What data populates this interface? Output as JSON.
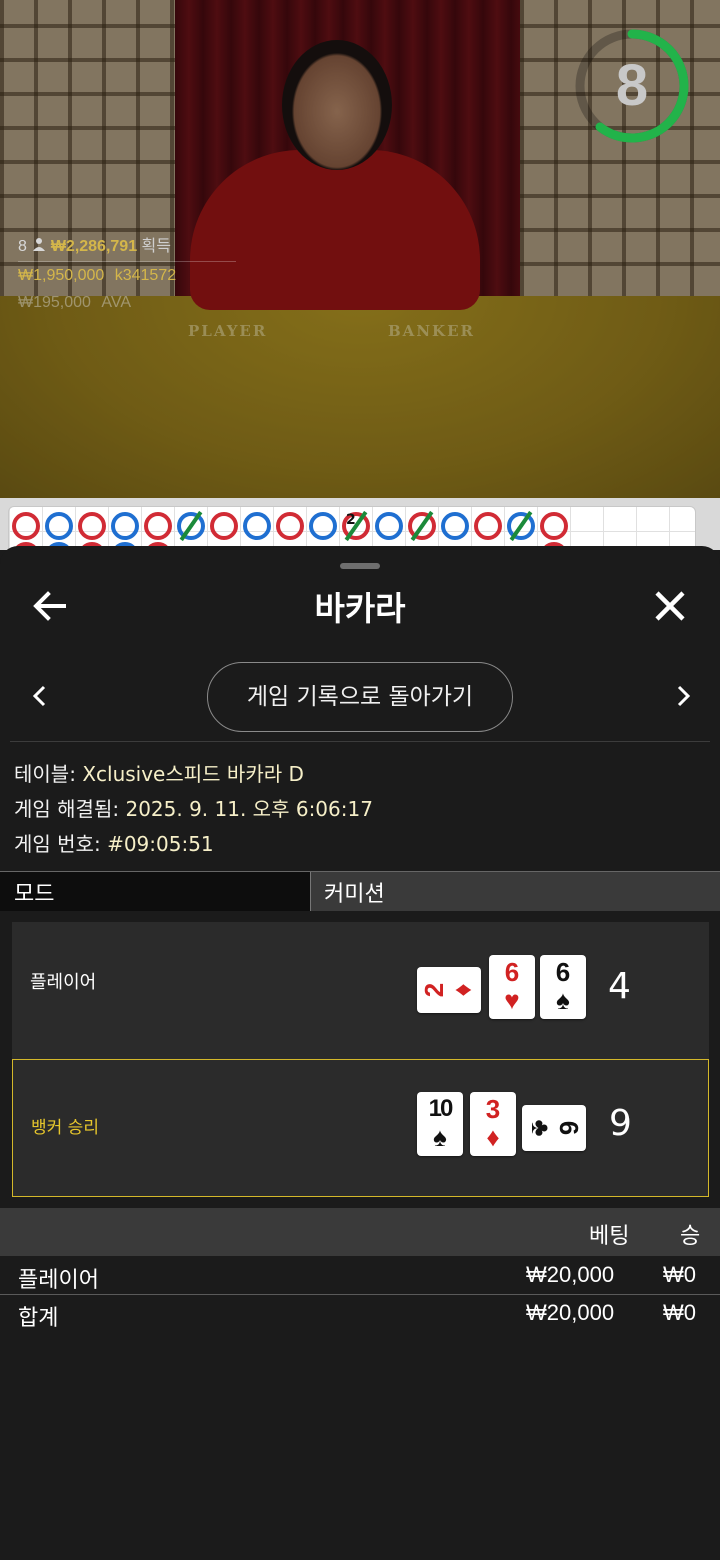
{
  "video": {
    "timer": "8",
    "table_labels": {
      "player": "PLAYER",
      "banker": "BANKER"
    },
    "winners": [
      {
        "count": "8",
        "amount": "₩2,286,791",
        "suffix": "획득"
      },
      {
        "amount": "₩1,950,000",
        "user": "k341572"
      },
      {
        "amount": "₩195,000",
        "user": "AVA"
      }
    ]
  },
  "roadmap": {
    "badge": "2"
  },
  "sheet": {
    "title": "바카라",
    "history_button": "게임 기록으로 돌아가기",
    "info": {
      "table_label": "테이블:",
      "table_value": "Xclusive스피드 바카라 D",
      "resolved_label": "게임 해결됨:",
      "resolved_value": "2025. 9. 11. 오후 6:06:17",
      "number_label": "게임 번호:",
      "number_value": "#09:05:51"
    },
    "mode": {
      "left": "모드",
      "right": "커미션"
    },
    "hands": {
      "player": {
        "label": "플레이어",
        "score": "4",
        "cards": [
          {
            "rank": "2",
            "suit": "♦",
            "color": "red"
          },
          {
            "rank": "6",
            "suit": "♥",
            "color": "red"
          },
          {
            "rank": "6",
            "suit": "♠",
            "color": "black"
          }
        ]
      },
      "banker": {
        "label": "뱅커 승리",
        "score": "9",
        "cards": [
          {
            "rank": "10",
            "suit": "♠",
            "color": "black"
          },
          {
            "rank": "3",
            "suit": "♦",
            "color": "red"
          },
          {
            "rank": "6",
            "suit": "♣",
            "color": "black"
          }
        ]
      }
    },
    "bets": {
      "headers": {
        "bet": "베팅",
        "win": "승"
      },
      "rows": [
        {
          "label": "플레이어",
          "bet": "₩20,000",
          "win": "₩0"
        },
        {
          "label": "합계",
          "bet": "₩20,000",
          "win": "₩0"
        }
      ]
    }
  },
  "colors": {
    "accent_gold": "#d4b82a",
    "timer_green": "#22b34a",
    "banker_red": "#d12b35",
    "player_blue": "#1f6fd1",
    "tie_green": "#1b8a3a"
  },
  "icons": [
    "back-arrow-icon",
    "close-icon",
    "chevron-left-icon",
    "chevron-right-icon",
    "person-icon"
  ]
}
